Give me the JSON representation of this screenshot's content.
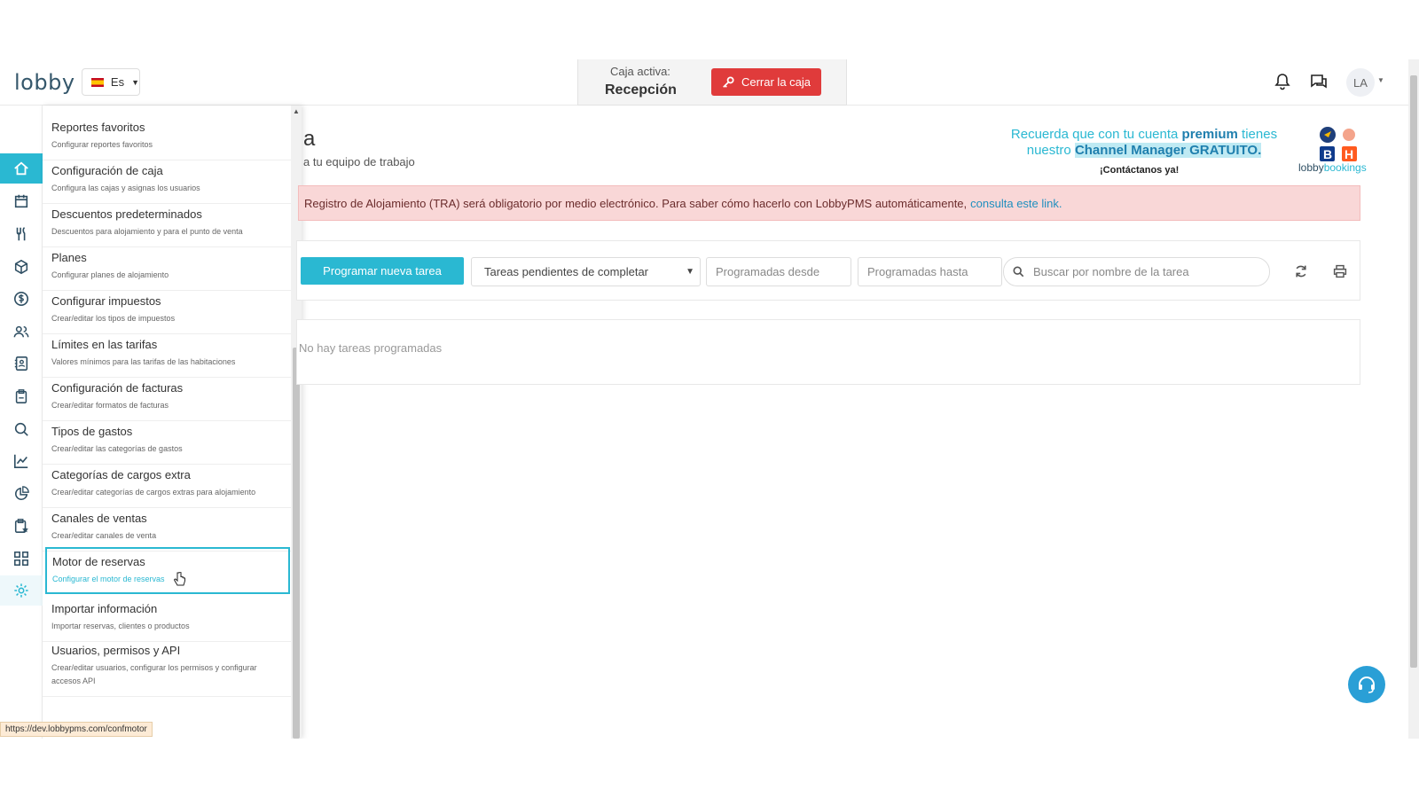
{
  "header": {
    "logo": "lobby",
    "lang": "Es",
    "cash_label": "Caja activa:",
    "cash_value": "Recepción",
    "close_cash": "Cerrar la caja",
    "avatar": "LA"
  },
  "menu": {
    "items": [
      {
        "title": "Reportes favoritos",
        "sub": "Configurar reportes favoritos"
      },
      {
        "title": "Configuración de caja",
        "sub": "Configura las cajas y asignas los usuarios"
      },
      {
        "title": "Descuentos predeterminados",
        "sub": "Descuentos para alojamiento y para el punto de venta"
      },
      {
        "title": "Planes",
        "sub": "Configurar planes de alojamiento"
      },
      {
        "title": "Configurar impuestos",
        "sub": "Crear/editar los tipos de impuestos"
      },
      {
        "title": "Límites en las tarifas",
        "sub": "Valores mínimos para las tarifas de las habitaciones"
      },
      {
        "title": "Configuración de facturas",
        "sub": "Crear/editar formatos de facturas"
      },
      {
        "title": "Tipos de gastos",
        "sub": "Crear/editar las categorías de gastos"
      },
      {
        "title": "Categorías de cargos extra",
        "sub": "Crear/editar categorías de cargos extras para alojamiento"
      },
      {
        "title": "Canales de ventas",
        "sub": "Crear/editar canales de venta"
      },
      {
        "title": "Motor de reservas",
        "sub": "Configurar el motor de reservas"
      },
      {
        "title": "Importar información",
        "sub": "Importar reservas, clientes o productos"
      },
      {
        "title": "Usuarios, permisos y API",
        "sub": "Crear/editar usuarios, configurar los permisos y configurar accesos API"
      }
    ],
    "selected_index": 10
  },
  "main": {
    "title": "a",
    "subtitle": "a tu equipo de trabajo",
    "promo_line1_a": "Recuerda que con tu cuenta ",
    "promo_line1_b": "premium",
    "promo_line1_c": " tienes",
    "promo_line2_a": "nuestro ",
    "promo_line2_b": "Channel Manager GRATUITO.",
    "promo_cta": "¡Contáctanos ya!",
    "brand_a": "lobby",
    "brand_b": "bookings",
    "alert_text": "Registro de Alojamiento (TRA) será obligatorio por medio electrónico. Para saber cómo hacerlo con LobbyPMS automáticamente,",
    "alert_link": "consulta este link.",
    "program_button": "Programar nueva tarea",
    "filter_select": "Tareas pendientes de completar",
    "date_from": "Programadas desde",
    "date_to": "Programadas hasta",
    "search_placeholder": "Buscar por nombre de la tarea",
    "empty_text": "No hay tareas programadas"
  },
  "status_url": "https://dev.lobbypms.com/confmotor",
  "colors": {
    "accent": "#2ab8d2",
    "danger": "#e03b3b",
    "alert_bg": "#f9d7d7"
  }
}
